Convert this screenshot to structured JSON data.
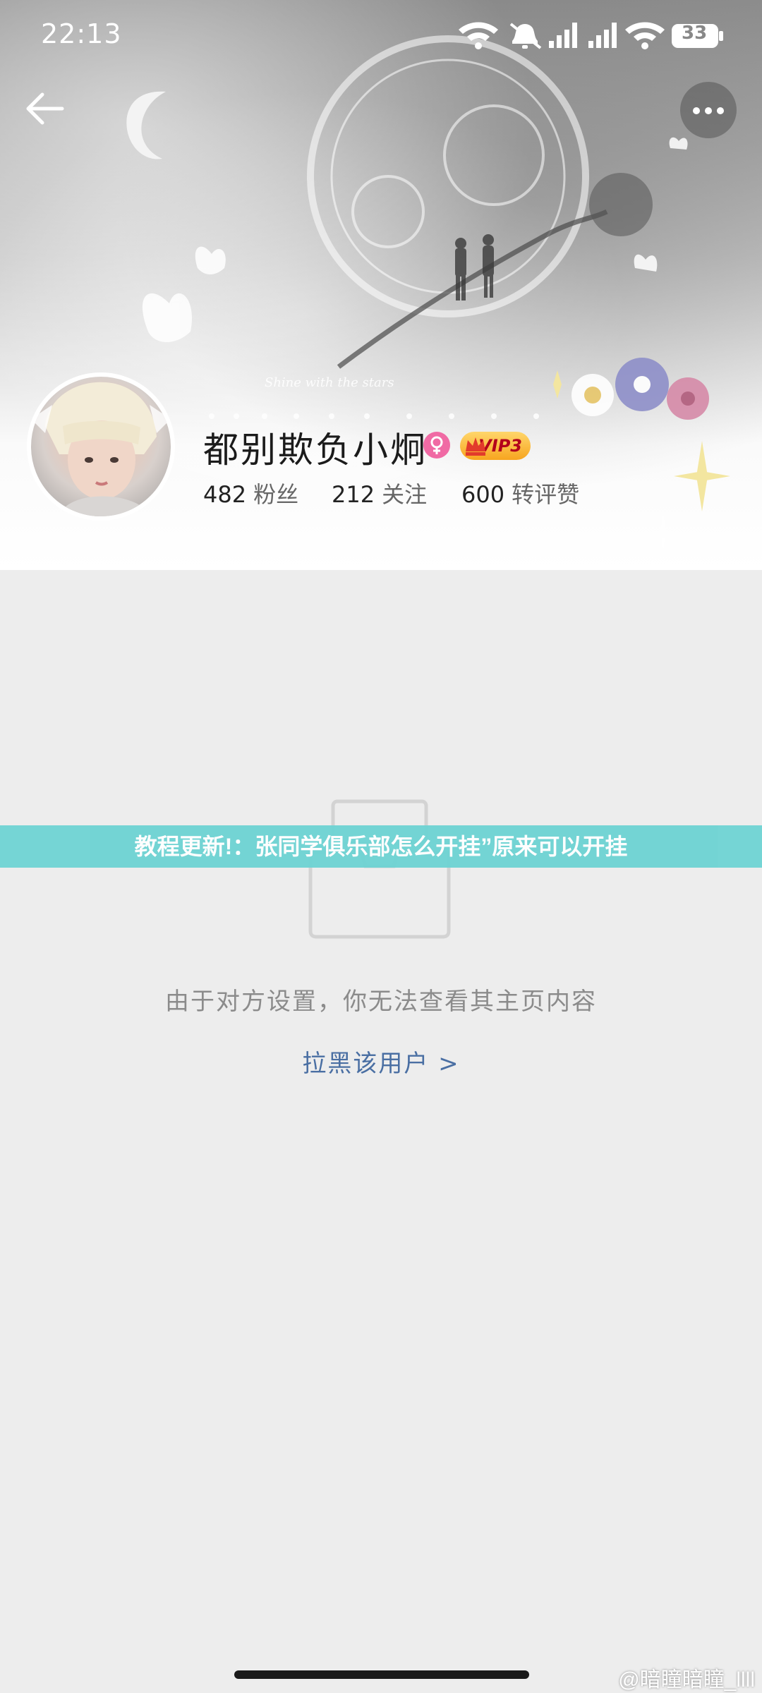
{
  "status_bar": {
    "time": "22:13",
    "battery": "33",
    "icons": [
      "wifi-icon",
      "bell-muted-icon",
      "signal-icon",
      "signal-icon",
      "wifi-icon",
      "battery-icon"
    ]
  },
  "nav": {
    "back_icon": "arrow-left-icon",
    "more_icon": "more-dots-icon"
  },
  "cover": {
    "tagline": "Shine with the stars"
  },
  "profile": {
    "name": "都别欺负小炯",
    "gender_icon": "female-icon",
    "vip_label": "VIP3",
    "stats": [
      {
        "value": "482",
        "label": "粉丝"
      },
      {
        "value": "212",
        "label": "关注"
      },
      {
        "value": "600",
        "label": "转评赞"
      }
    ]
  },
  "empty_state": {
    "icon": "empty-box-icon",
    "message": "由于对方设置，你无法查看其主页内容",
    "action": "拉黑该用户 >"
  },
  "banner": {
    "text": "教程更新!：张同学俱乐部怎么开挂”原来可以开挂"
  },
  "watermark": {
    "text": "@暗瞳暗瞳_llll"
  },
  "colors": {
    "background": "#ededed",
    "banner": "#6fd3d3",
    "link": "#4a6fa3",
    "vip": "#f7a51f",
    "gender": "#f06aa4"
  }
}
